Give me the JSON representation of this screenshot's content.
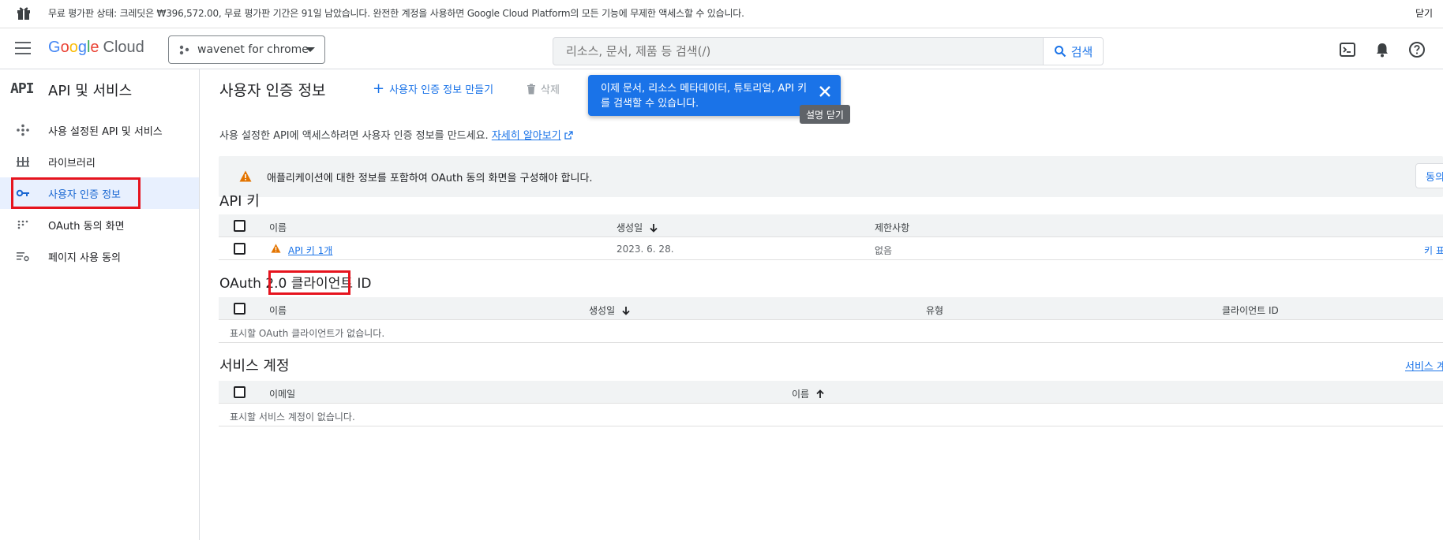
{
  "banner": {
    "message": "무료 평가판 상태: 크레딧은 ₩396,572.00, 무료 평가판 기간은 91일 남았습니다. 완전한 계정을 사용하면 Google Cloud Platform의 모든 기능에 무제한 액세스할 수 있습니다.",
    "close_label": "닫기"
  },
  "header": {
    "logo_letters": [
      "G",
      "o",
      "o",
      "g",
      "l",
      "e"
    ],
    "logo_cloud": "Cloud",
    "project_name": "wavenet for chrome",
    "search_placeholder": "리소스, 문서, 제품 등 검색(/)",
    "search_button": "검색"
  },
  "sidebar": {
    "logo": "API",
    "title": "API 및 서비스",
    "items": [
      {
        "label": "사용 설정된 API 및 서비스",
        "icon": "diamond-dots-icon"
      },
      {
        "label": "라이브러리",
        "icon": "library-icon"
      },
      {
        "label": "사용자 인증 정보",
        "icon": "key-icon",
        "active": true
      },
      {
        "label": "OAuth 동의 화면",
        "icon": "dot-grid-icon"
      },
      {
        "label": "페이지 사용 동의",
        "icon": "settings-list-icon"
      }
    ]
  },
  "main": {
    "title": "사용자 인증 정보",
    "create_label": "사용자 인증 정보 만들기",
    "delete_label": "삭제",
    "tooltip_text": "이제 문서, 리소스 메타데이터, 튜토리얼, API 키를 검색할 수 있습니다.",
    "tooltip_close_label": "설명 닫기",
    "intro_text": "사용 설정한 API에 액세스하려면 사용자 인증 정보를 만드세요.",
    "intro_link": "자세히 알아보기",
    "warning_text": "애플리케이션에 대한 정보를 포함하여 OAuth 동의 화면을 구성해야 합니다.",
    "warning_button": "동의 화면 구성",
    "api_keys": {
      "title": "API 키",
      "columns": [
        "이름",
        "생성일",
        "제한사항"
      ],
      "rows": [
        {
          "name": "API 키 1개",
          "created": "2023. 6. 28.",
          "restrictions": "없음",
          "action": "키 표시"
        }
      ]
    },
    "oauth": {
      "title": "OAuth 2.0 클라이언트 ID",
      "columns": [
        "이름",
        "생성일",
        "유형",
        "클라이언트 ID"
      ],
      "empty": "표시할 OAuth 클라이언트가 없습니다."
    },
    "service_accounts": {
      "title": "서비스 계정",
      "manage_link": "서비스 계정 관리",
      "columns": [
        "이메일",
        "이름"
      ],
      "empty": "표시할 서비스 계정이 없습니다."
    }
  },
  "colors": {
    "accent": "#1a73e8",
    "warning": "#e37400",
    "highlight_red": "#e6141e",
    "active_bg": "#e8f0fe"
  }
}
